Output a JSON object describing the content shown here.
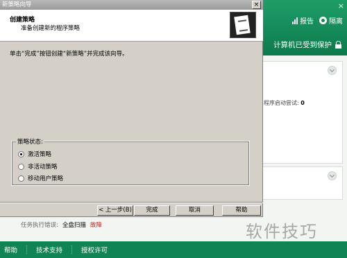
{
  "background_app": {
    "close_glyph": "×",
    "toolbar": [
      {
        "label": "报告",
        "icon": "bar-chart-icon"
      },
      {
        "label": "隔离",
        "icon": "radiation-icon"
      }
    ],
    "status_text": "计算机已受到保护",
    "status_icon": "lock-icon",
    "attempts_label": "程序启动尝试:",
    "attempts_value": "0",
    "task": {
      "label": "任务执行错误:",
      "name": "全盘扫描",
      "status": "故障"
    },
    "footer": [
      "帮助",
      "技术支持",
      "授权许可"
    ]
  },
  "wizard": {
    "title": "新策略向导",
    "close_glyph": "×",
    "header_title": "创建策略",
    "header_subtitle": "准备创建新的程序策略",
    "instruction": "单击“完成”按钮创建“新策略”并完成该向导。",
    "group_label": "策略状态:",
    "options": [
      {
        "label": "激活策略",
        "selected": true
      },
      {
        "label": "非活动策略",
        "selected": false
      },
      {
        "label": "移动用户策略",
        "selected": false
      }
    ],
    "buttons": {
      "back": "< 上一步(B)",
      "finish": "完成",
      "cancel": "取消",
      "help": "帮助"
    }
  },
  "watermark": "软件技巧",
  "colors": {
    "brand_green": "#118453",
    "dialog_face": "#d4d0c8",
    "error_red": "#c0231c"
  }
}
